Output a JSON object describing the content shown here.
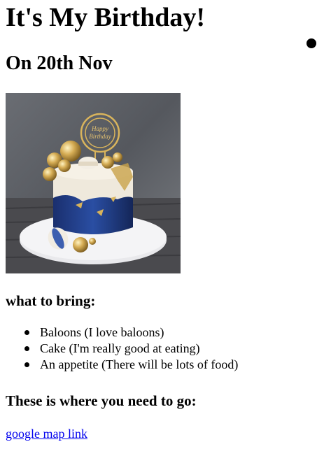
{
  "header": {
    "title": "It's My Birthday!",
    "date": "On 20th Nov"
  },
  "image": {
    "alt_icon": "birthday-cake-image",
    "topper_text": "Happy Birthday",
    "colors": {
      "cake_blue": "#1f3d8a",
      "cream": "#efe9dc",
      "gold": "#c9a24a",
      "background": "#5a5d63"
    }
  },
  "bring": {
    "heading": "what to bring:",
    "items": [
      "Baloons (I love baloons)",
      "Cake (I'm really good at eating)",
      "An appetite (There will be lots of food)"
    ]
  },
  "location": {
    "heading": "These is where you need to go:",
    "link_text": "google map link"
  },
  "colors": {
    "link": "#0000ee",
    "text": "#000000"
  }
}
